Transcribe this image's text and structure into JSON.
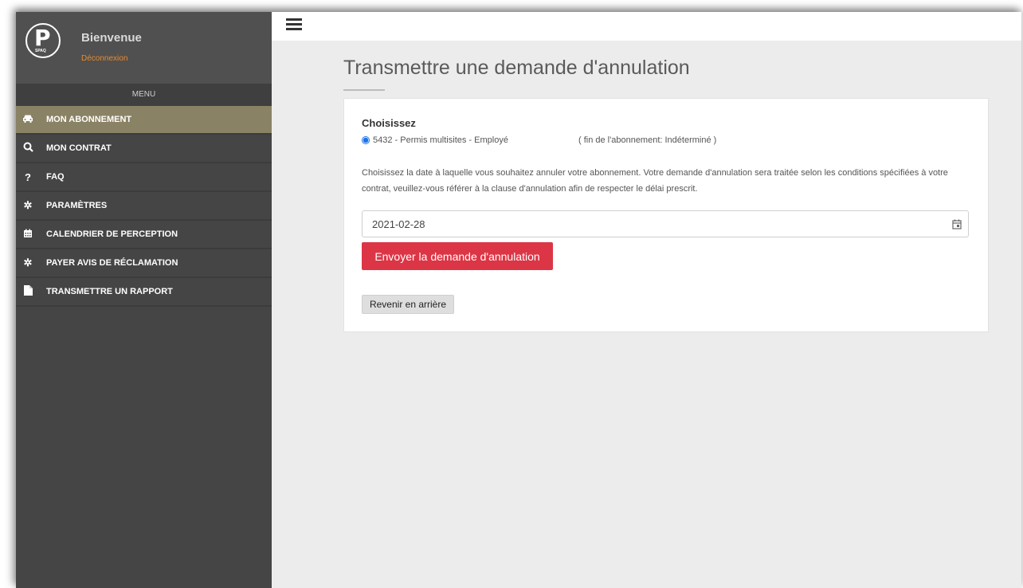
{
  "sidebar": {
    "logo_text": "SPAQ",
    "welcome": "Bienvenue",
    "logout": "Déconnexion",
    "menu_header": "MENU",
    "items": [
      {
        "label": "MON ABONNEMENT",
        "icon": "car-icon"
      },
      {
        "label": "MON CONTRAT",
        "icon": "search-icon"
      },
      {
        "label": "FAQ",
        "icon": "question-icon"
      },
      {
        "label": "PARAMÈTRES",
        "icon": "gear-icon"
      },
      {
        "label": "CALENDRIER DE PERCEPTION",
        "icon": "calendar-icon"
      },
      {
        "label": "PAYER AVIS DE RÉCLAMATION",
        "icon": "gear-icon"
      },
      {
        "label": "TRANSMETTRE UN RAPPORT",
        "icon": "file-icon"
      }
    ]
  },
  "main": {
    "title": "Transmettre une demande d'annulation",
    "choose_label": "Choisissez",
    "subscription_option": "5432 - Permis multisites - Employé",
    "end_info": "( fin de l'abonnement: Indéterminé )",
    "description": "Choisissez la date à laquelle vous souhaitez annuler votre abonnement. Votre demande d'annulation sera traitée selon les conditions spécifiées à votre contrat, veuillez-vous référer à la clause d'annulation afin de respecter le délai prescrit.",
    "date_value": "2021-02-28",
    "send_button": "Envoyer la demande d'annulation",
    "back_button": "Revenir en arrière"
  },
  "colors": {
    "sidebar_bg": "#454545",
    "active_item": "#8a8264",
    "logout_link": "#e88b2f",
    "send_button": "#dc3545"
  }
}
